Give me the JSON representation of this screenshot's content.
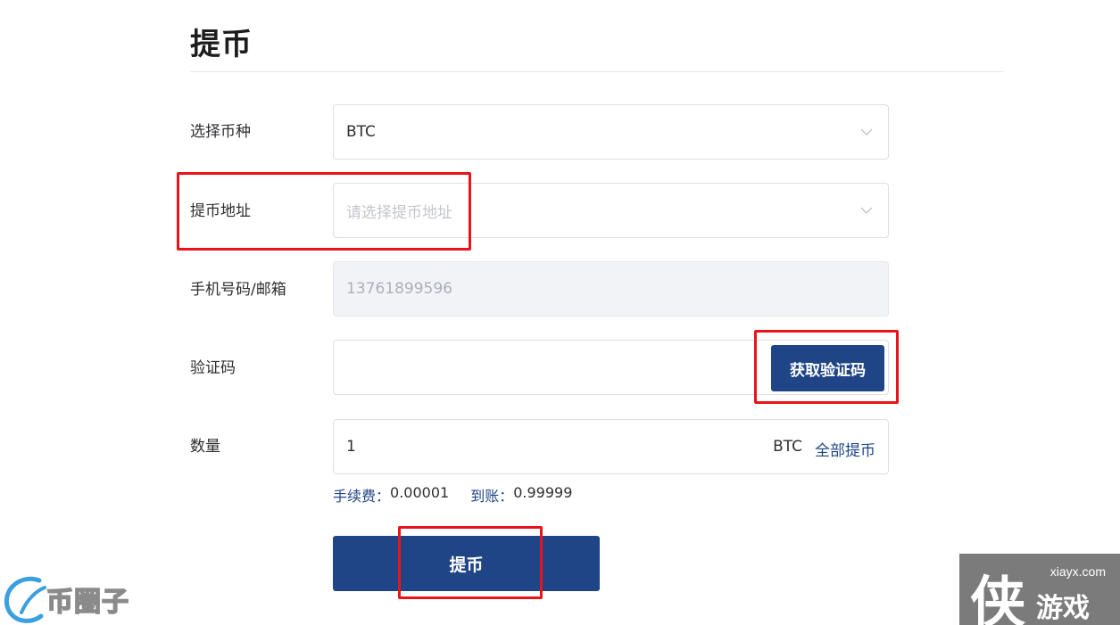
{
  "page": {
    "title": "提币"
  },
  "form": {
    "currency": {
      "label": "选择币种",
      "value": "BTC"
    },
    "address": {
      "label": "提币地址",
      "placeholder": "请选择提币地址"
    },
    "contact": {
      "label": "手机号码/邮箱",
      "value": "13761899596"
    },
    "code": {
      "label": "验证码",
      "value": "",
      "button_label": "获取验证码"
    },
    "amount": {
      "label": "数量",
      "value": "1",
      "unit": "BTC",
      "all_label": "全部提币"
    },
    "fee": {
      "fee_label": "手续费：",
      "fee_value": "0.00001",
      "receive_label": "到账：",
      "receive_value": "0.99999"
    },
    "submit_label": "提币"
  },
  "watermarks": {
    "left": {
      "text": "币圈子"
    },
    "right": {
      "url": "xiayx.com",
      "glyph": "侠",
      "text": "游戏"
    }
  },
  "colors": {
    "primary": "#1f4587",
    "highlight": "#e8141a",
    "border": "#dcdfe6",
    "disabled_bg": "#f2f3f7"
  }
}
